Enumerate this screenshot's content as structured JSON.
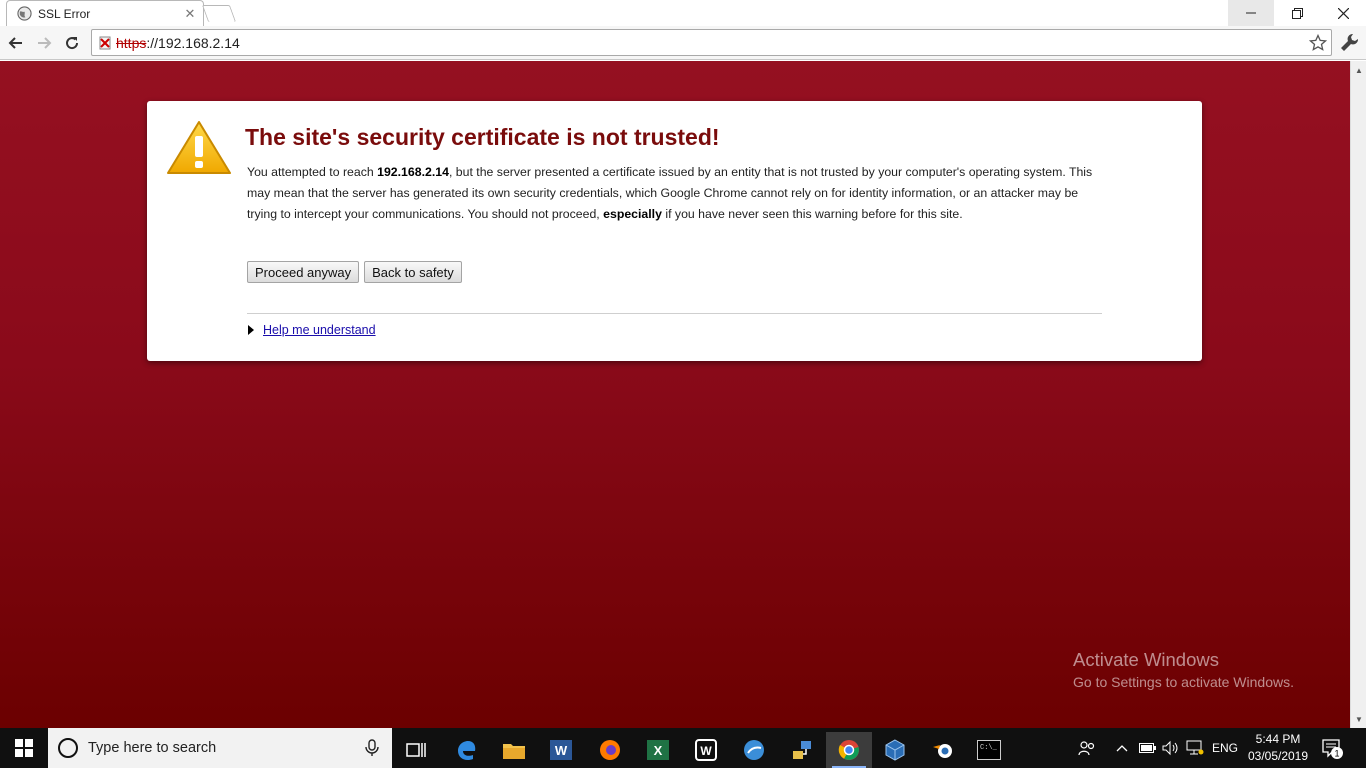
{
  "tab": {
    "title": "SSL Error"
  },
  "address_bar": {
    "scheme": "https",
    "rest": "://192.168.2.14"
  },
  "error": {
    "title": "The site's security certificate is not trusted!",
    "body_1": "You attempted to reach ",
    "host": "192.168.2.14",
    "body_2": ", but the server presented a certificate issued by an entity that is not trusted by your computer's operating system. This may mean that the server has generated its own security credentials, which Google Chrome cannot rely on for identity information, or an attacker may be trying to intercept your communications. You should not proceed, ",
    "emphasis": "especially",
    "body_3": " if you have never seen this warning before for this site.",
    "proceed_label": "Proceed anyway",
    "back_label": "Back to safety",
    "help_label": "Help me understand"
  },
  "watermark": {
    "title": "Activate Windows",
    "subtitle": "Go to Settings to activate Windows."
  },
  "taskbar": {
    "search_placeholder": "Type here to search",
    "apps": [
      "task-view",
      "edge",
      "file-explorer",
      "word",
      "firefox",
      "excel",
      "wiki-app",
      "browser-app",
      "network-app",
      "chrome",
      "virtualbox",
      "blender",
      "terminal"
    ],
    "language": "ENG",
    "time": "5:44 PM",
    "date": "03/05/2019",
    "notification_count": "1"
  },
  "colors": {
    "page_background": "#8a0a1a",
    "title_red": "#7a0c0c",
    "link": "#1a0dab"
  }
}
